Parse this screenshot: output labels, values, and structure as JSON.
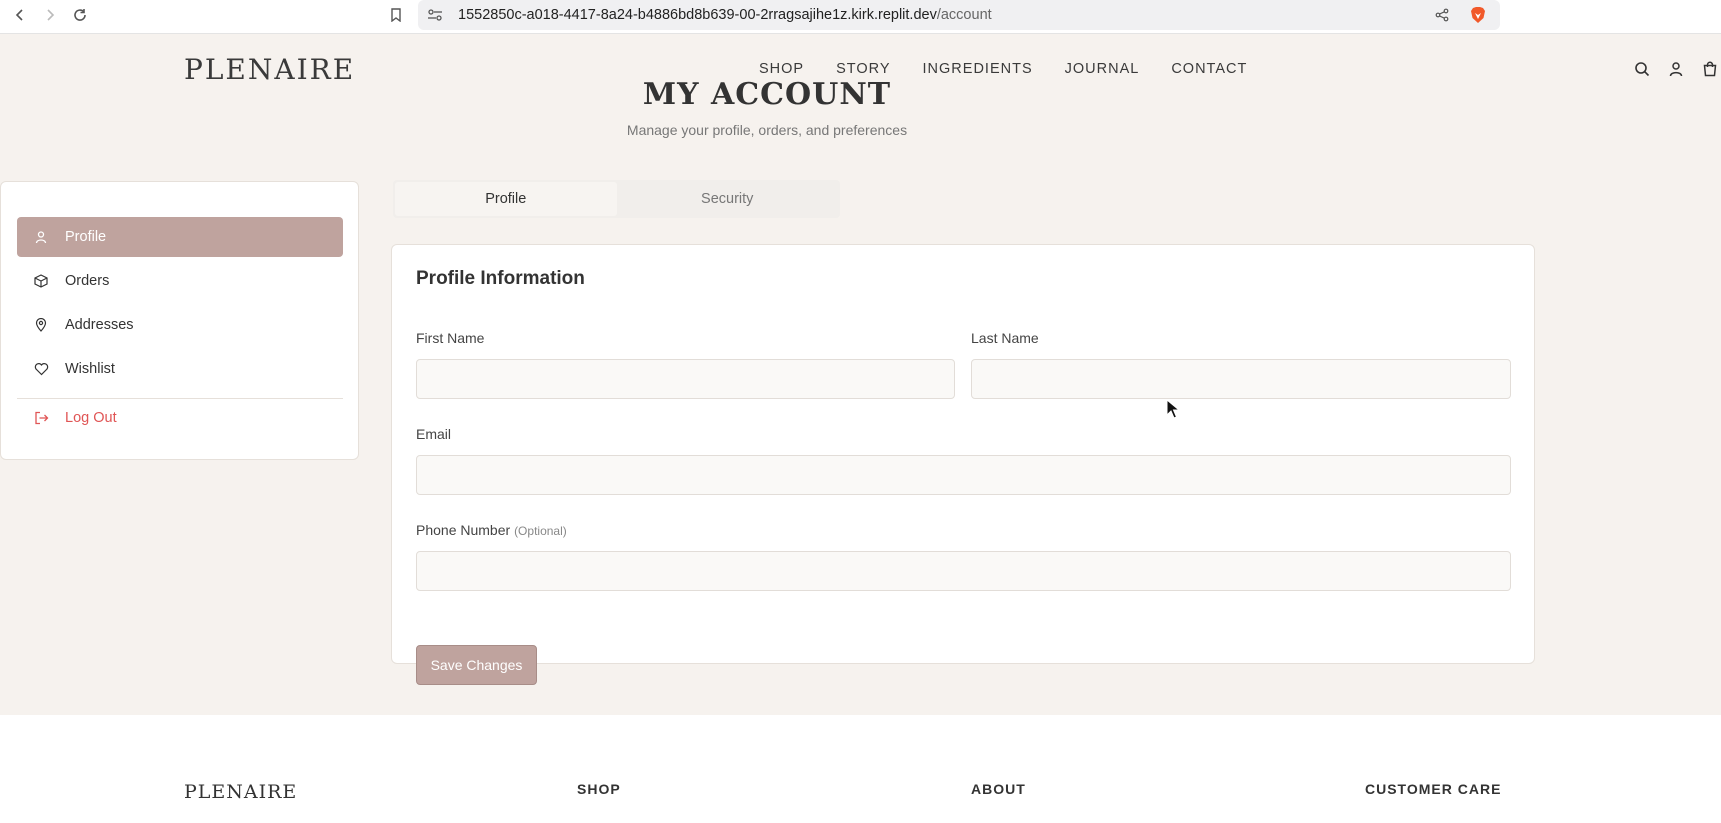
{
  "browser": {
    "url_host": "1552850c-a018-4417-8a24-b4886bd8b639-00-2rragsajihe1z.kirk.replit.dev",
    "url_path": "/account",
    "icons": [
      "back-icon",
      "forward-icon",
      "reload-icon",
      "bookmark-icon",
      "site-settings-icon",
      "share-icon",
      "brave-icon"
    ]
  },
  "header": {
    "logo": "PLENAIRE",
    "nav": [
      "SHOP",
      "STORY",
      "INGREDIENTS",
      "JOURNAL",
      "CONTACT"
    ],
    "icons": [
      "search-icon",
      "user-icon",
      "cart-icon"
    ]
  },
  "page": {
    "title": "MY ACCOUNT",
    "subtitle": "Manage your profile, orders, and preferences"
  },
  "sidebar": {
    "items": [
      {
        "label": "Profile",
        "icon": "user-icon",
        "active": true
      },
      {
        "label": "Orders",
        "icon": "package-icon",
        "active": false
      },
      {
        "label": "Addresses",
        "icon": "map-pin-icon",
        "active": false
      },
      {
        "label": "Wishlist",
        "icon": "heart-icon",
        "active": false
      }
    ],
    "logout": {
      "label": "Log Out",
      "icon": "logout-icon"
    }
  },
  "tabs": [
    {
      "label": "Profile",
      "active": true
    },
    {
      "label": "Security",
      "active": false
    }
  ],
  "profile_form": {
    "title": "Profile Information",
    "first_name": {
      "label": "First Name",
      "value": "",
      "placeholder": ""
    },
    "last_name": {
      "label": "Last Name",
      "value": "",
      "placeholder": ""
    },
    "email": {
      "label": "Email",
      "value": "",
      "placeholder": ""
    },
    "phone": {
      "label": "Phone Number",
      "optional": "(Optional)",
      "value": "",
      "placeholder": ""
    },
    "save_label": "Save Changes"
  },
  "footer": {
    "logo": "PLENAIRE",
    "columns": [
      "SHOP",
      "ABOUT",
      "CUSTOMER CARE"
    ]
  },
  "colors": {
    "accent": "#bfa39e",
    "background": "#f6f2ee",
    "logout": "#e05555"
  }
}
